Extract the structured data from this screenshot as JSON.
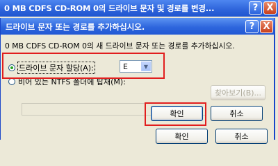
{
  "background_dialog": {
    "title": "0 MB CDFS  CD-ROM 0의 드라이브 문자 및 경로를 변경...",
    "help_symbol": "?",
    "close_symbol": "X",
    "ok_label": "확인",
    "cancel_label": "취소"
  },
  "dialog": {
    "title": "드라이브 문자 또는 경로를 추가하십시오.",
    "help_symbol": "?",
    "close_symbol": "X",
    "instruction": "0 MB CDFS  CD-ROM 0의 새 드라이브 문자 또는 경로를 추가하십시오.",
    "option_assign_letter": {
      "label": "드라이브 문자 할당(A):",
      "checked": true,
      "selected_letter": "E"
    },
    "option_mount_folder": {
      "label": "비어 있는 NTFS 폴더에 탑재(M):",
      "checked": false,
      "path_value": ""
    },
    "browse_label": "찾아보기(B)...",
    "ok_label": "확인",
    "cancel_label": "취소"
  },
  "colors": {
    "highlight": "#e11e1e",
    "titlebar": "#2e66dd",
    "window": "#ece9d8"
  }
}
